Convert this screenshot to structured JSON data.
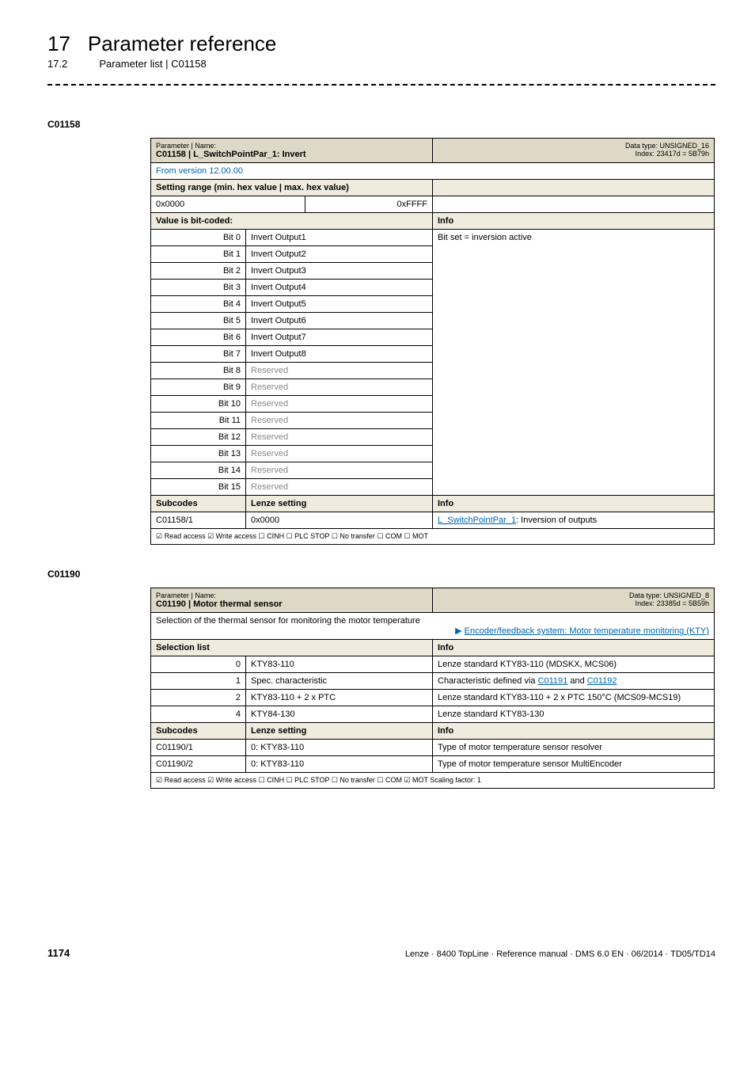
{
  "header": {
    "chapter_number": "17",
    "chapter_title": "Parameter reference",
    "section_number": "17.2",
    "section_title": "Parameter list | C01158"
  },
  "param1": {
    "id": "C01158",
    "title_left": "Parameter | Name:",
    "title_param": "C01158 | L_SwitchPointPar_1: Invert",
    "dtype": "Data type: UNSIGNED_16",
    "index": "Index: 23417d = 5B79h",
    "version": "From version 12.00.00",
    "setting_range_label": "Setting range (min. hex value | max. hex value)",
    "min_hex": "0x0000",
    "max_hex": "0xFFFF",
    "bitcoded_label": "Value is bit-coded:",
    "info_label": "Info",
    "bit_info": "Bit set = inversion active",
    "bits": [
      {
        "bit": "Bit 0",
        "desc": "Invert Output1"
      },
      {
        "bit": "Bit 1",
        "desc": "Invert Output2"
      },
      {
        "bit": "Bit 2",
        "desc": "Invert Output3"
      },
      {
        "bit": "Bit 3",
        "desc": "Invert Output4"
      },
      {
        "bit": "Bit 4",
        "desc": "Invert Output5"
      },
      {
        "bit": "Bit 5",
        "desc": "Invert Output6"
      },
      {
        "bit": "Bit 6",
        "desc": "Invert Output7"
      },
      {
        "bit": "Bit 7",
        "desc": "Invert Output8"
      },
      {
        "bit": "Bit 8",
        "desc": "Reserved"
      },
      {
        "bit": "Bit 9",
        "desc": "Reserved"
      },
      {
        "bit": "Bit 10",
        "desc": "Reserved"
      },
      {
        "bit": "Bit 11",
        "desc": "Reserved"
      },
      {
        "bit": "Bit 12",
        "desc": "Reserved"
      },
      {
        "bit": "Bit 13",
        "desc": "Reserved"
      },
      {
        "bit": "Bit 14",
        "desc": "Reserved"
      },
      {
        "bit": "Bit 15",
        "desc": "Reserved"
      }
    ],
    "subcodes_label": "Subcodes",
    "lenze_label": "Lenze setting",
    "sub_code": "C01158/1",
    "sub_value": "0x0000",
    "sub_link_text": "L_SwitchPointPar_1",
    "sub_link_suffix": ": Inversion of outputs",
    "access": "☑ Read access   ☑ Write access   ☐ CINH   ☐ PLC STOP   ☐ No transfer   ☐ COM   ☐ MOT"
  },
  "param2": {
    "id": "C01190",
    "title_left": "Parameter | Name:",
    "title_param": "C01190 | Motor thermal sensor",
    "dtype": "Data type: UNSIGNED_8",
    "index": "Index: 23385d = 5B59h",
    "desc_text": "Selection of the thermal sensor for monitoring the motor temperature",
    "desc_link_prefix": "▶ ",
    "desc_link": "Encoder/feedback system: Motor temperature monitoring (KTY)",
    "selection_label": "Selection list",
    "info_label": "Info",
    "rows": [
      {
        "n": "0",
        "name": "KTY83-110",
        "info_plain": "Lenze standard KTY83-110 (MDSKX, MCS06)"
      },
      {
        "n": "1",
        "name": "Spec. characteristic",
        "info_pre": "Characteristic defined via ",
        "link1": "C01191",
        "mid": " and ",
        "link2": "C01192"
      },
      {
        "n": "2",
        "name": "KTY83-110 + 2 x PTC",
        "info_plain": "Lenze standard KTY83-110 + 2 x PTC 150°C (MCS09-MCS19)"
      },
      {
        "n": "4",
        "name": "KTY84-130",
        "info_plain": "Lenze standard KTY83-130"
      }
    ],
    "subcodes_label": "Subcodes",
    "lenze_label": "Lenze setting",
    "sub_rows": [
      {
        "code": "C01190/1",
        "val": "0: KTY83-110",
        "info": "Type of motor temperature sensor resolver"
      },
      {
        "code": "C01190/2",
        "val": "0: KTY83-110",
        "info": "Type of motor temperature sensor MultiEncoder"
      }
    ],
    "access": "☑ Read access   ☑ Write access   ☐ CINH   ☐ PLC STOP   ☐ No transfer   ☐ COM   ☑ MOT      Scaling factor: 1"
  },
  "footer": {
    "page": "1174",
    "doc": "Lenze · 8400 TopLine · Reference manual · DMS 6.0 EN · 06/2014 · TD05/TD14"
  }
}
